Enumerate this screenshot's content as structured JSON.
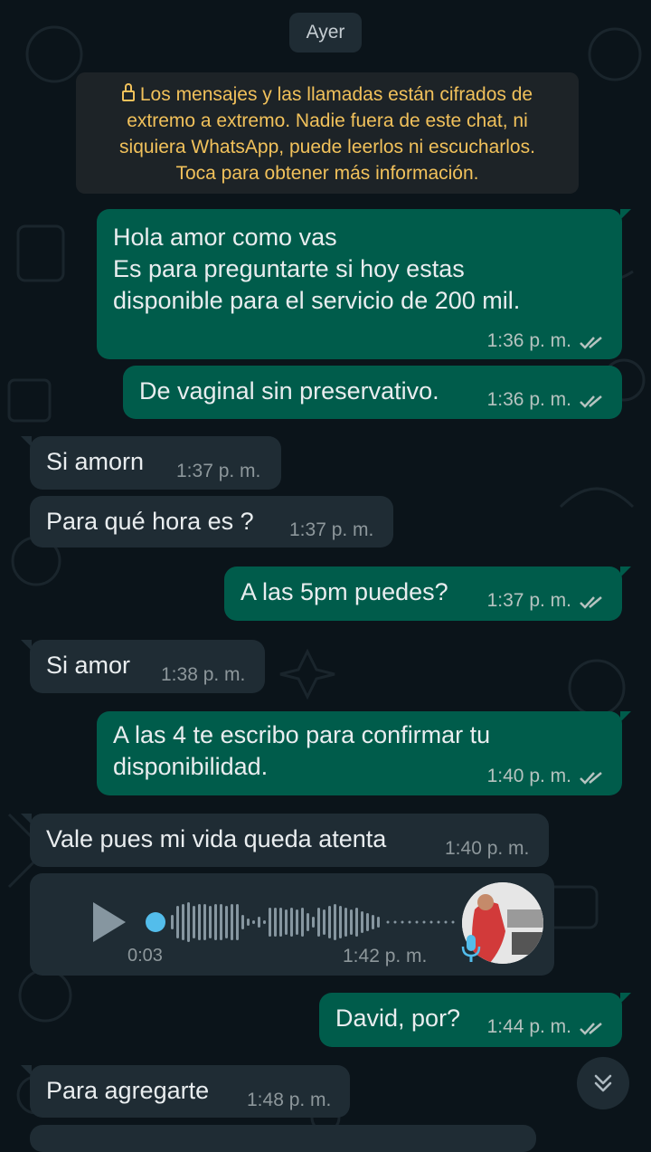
{
  "date_chip": "Ayer",
  "system_note": {
    "lines": [
      "Los mensajes y las llamadas están cifrados de",
      "extremo a extremo. Nadie fuera de este chat, ni",
      "siquiera WhatsApp, puede leerlos ni escucharlos.",
      "Toca para obtener más información."
    ]
  },
  "messages": [
    {
      "dir": "out",
      "lines": [
        "Hola amor como vas",
        "Es para preguntarte si hoy estas",
        "disponible para el servicio de 200 mil."
      ],
      "time": "1:36 p. m.",
      "status": "read"
    },
    {
      "dir": "out",
      "lines": [
        "De vaginal sin preservativo."
      ],
      "time": "1:36 p. m.",
      "status": "read"
    },
    {
      "dir": "in",
      "lines": [
        "Si amorn"
      ],
      "time": "1:37 p. m."
    },
    {
      "dir": "in",
      "lines": [
        "Para qué hora es ?"
      ],
      "time": "1:37 p. m."
    },
    {
      "dir": "out",
      "lines": [
        "A las 5pm puedes?"
      ],
      "time": "1:37 p. m.",
      "status": "read"
    },
    {
      "dir": "in",
      "lines": [
        "Si amor"
      ],
      "time": "1:38 p. m."
    },
    {
      "dir": "out",
      "lines": [
        "A las 4 te escribo para confirmar tu",
        "disponibilidad."
      ],
      "time": "1:40 p. m.",
      "status": "read"
    },
    {
      "dir": "in",
      "lines": [
        "Vale pues mi vida queda atenta"
      ],
      "time": "1:40 p. m."
    },
    {
      "dir": "out",
      "lines": [
        "David, por?"
      ],
      "time": "1:44 p. m.",
      "status": "read"
    },
    {
      "dir": "in",
      "lines": [
        "Para agregarte"
      ],
      "time": "1:48 p. m."
    }
  ],
  "voice_note": {
    "duration": "0:03",
    "time": "1:42 p. m.",
    "progress": 0.0
  },
  "icons": {
    "lock": "lock-icon",
    "ticks": "double-check-icon",
    "play": "play-icon",
    "mic": "microphone-icon",
    "scroll": "double-chevron-down-icon"
  },
  "colors": {
    "background": "#0b141a",
    "outgoing_bubble": "#005c4b",
    "incoming_bubble": "#1f2c34",
    "read_ticks": "#b6c3c0",
    "system_text": "#f1c15b",
    "voice_dot": "#53bdeb"
  }
}
